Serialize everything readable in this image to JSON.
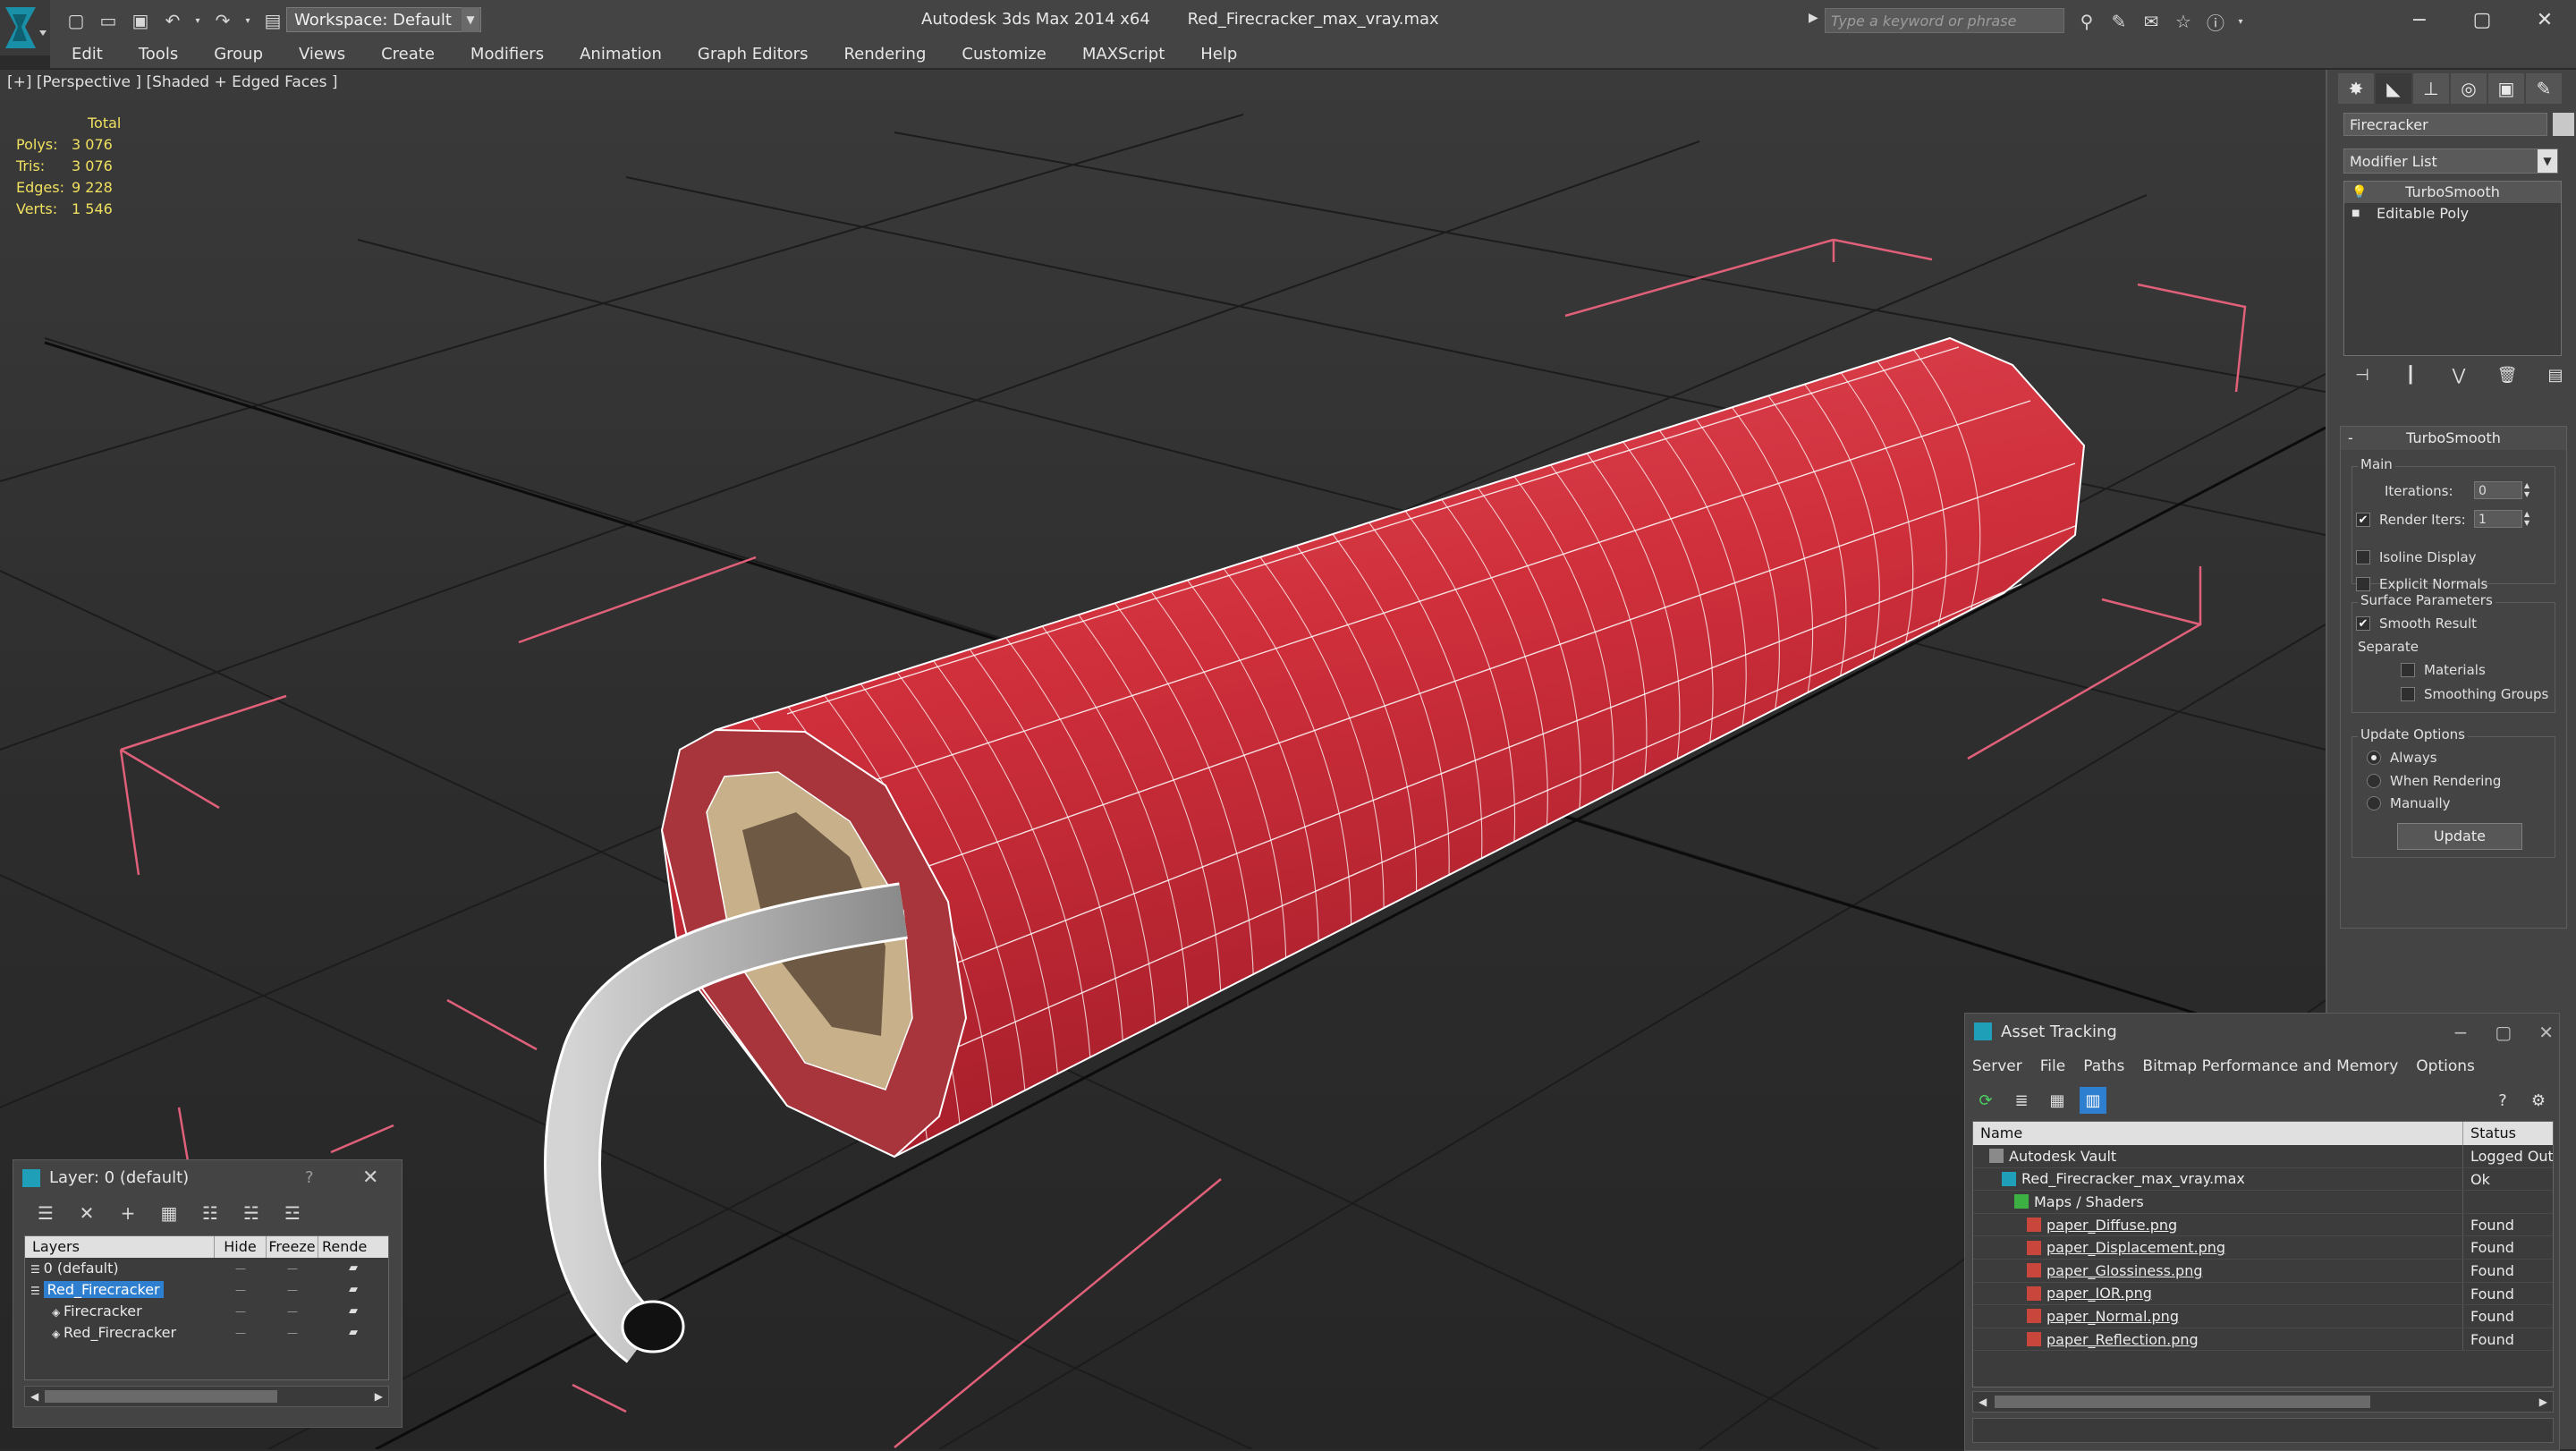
{
  "app": {
    "title": "Autodesk 3ds Max  2014 x64",
    "file": "Red_Firecracker_max_vray.max",
    "workspace": "Workspace: Default",
    "search_placeholder": "Type a keyword or phrase"
  },
  "menu": [
    "Edit",
    "Tools",
    "Group",
    "Views",
    "Create",
    "Modifiers",
    "Animation",
    "Graph Editors",
    "Rendering",
    "Customize",
    "MAXScript",
    "Help"
  ],
  "viewport": {
    "label": "[+] [Perspective ] [Shaded + Edged Faces ]",
    "stats": {
      "header": "Total",
      "rows": [
        {
          "k": "Polys:",
          "v": "3 076"
        },
        {
          "k": "Tris:",
          "v": "3 076"
        },
        {
          "k": "Edges:",
          "v": "9 228"
        },
        {
          "k": "Verts:",
          "v": "1 546"
        }
      ]
    }
  },
  "command_panel": {
    "object_name": "Firecracker",
    "modifier_list": "Modifier List",
    "stack": [
      "TurboSmooth",
      "Editable Poly"
    ],
    "rollout": {
      "title": "TurboSmooth",
      "main": "Main",
      "iterations_label": "Iterations:",
      "iterations_value": "0",
      "render_iters_label": "Render Iters:",
      "render_iters_value": "1",
      "isoline": "Isoline Display",
      "explicit_normals": "Explicit Normals",
      "surface_params": "Surface Parameters",
      "smooth_result": "Smooth Result",
      "separate": "Separate",
      "materials": "Materials",
      "smoothing_groups": "Smoothing Groups",
      "update_options": "Update Options",
      "always": "Always",
      "when_rendering": "When Rendering",
      "manually": "Manually",
      "update_button": "Update"
    }
  },
  "asset_tracking": {
    "title": "Asset Tracking",
    "menu": [
      "Server",
      "File",
      "Paths",
      "Bitmap Performance and Memory",
      "Options"
    ],
    "columns": {
      "name": "Name",
      "status": "Status"
    },
    "rows": [
      {
        "name": "Autodesk Vault",
        "status": "Logged Out",
        "indent": 0,
        "kind": "vault"
      },
      {
        "name": "Red_Firecracker_max_vray.max",
        "status": "Ok",
        "indent": 1,
        "kind": "max"
      },
      {
        "name": "Maps / Shaders",
        "status": "",
        "indent": 2,
        "kind": "folder"
      },
      {
        "name": "paper_Diffuse.png",
        "status": "Found",
        "indent": 3,
        "kind": "png"
      },
      {
        "name": "paper_Displacement.png",
        "status": "Found",
        "indent": 3,
        "kind": "png"
      },
      {
        "name": "paper_Glossiness.png",
        "status": "Found",
        "indent": 3,
        "kind": "png"
      },
      {
        "name": "paper_IOR.png",
        "status": "Found",
        "indent": 3,
        "kind": "png"
      },
      {
        "name": "paper_Normal.png",
        "status": "Found",
        "indent": 3,
        "kind": "png"
      },
      {
        "name": "paper_Reflection.png",
        "status": "Found",
        "indent": 3,
        "kind": "png"
      }
    ]
  },
  "layer_window": {
    "title": "Layer: 0 (default)",
    "help": "?",
    "columns": {
      "layers": "Layers",
      "hide": "Hide",
      "freeze": "Freeze",
      "render": "Rende"
    },
    "rows": [
      {
        "name": "0 (default)",
        "indent": 0,
        "selected": false
      },
      {
        "name": "Red_Firecracker",
        "indent": 0,
        "selected": true
      },
      {
        "name": "Firecracker",
        "indent": 1,
        "selected": false
      },
      {
        "name": "Red_Firecracker",
        "indent": 1,
        "selected": false
      }
    ]
  },
  "colors": {
    "accent": "#2f7fd0",
    "stats_yellow": "#f0e060",
    "firecracker_red": "#d3343f",
    "fuse_gray": "#a8a8a8"
  }
}
